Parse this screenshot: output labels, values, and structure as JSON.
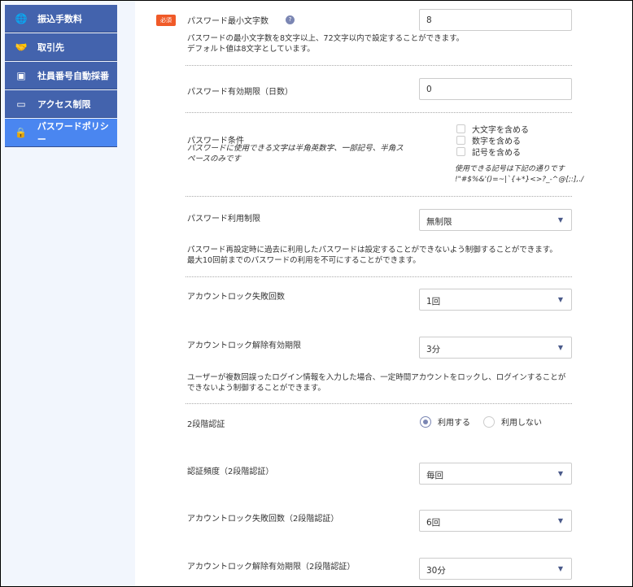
{
  "sidebar": {
    "items": [
      {
        "label": "振込手数料",
        "icon": "globe-yen-icon"
      },
      {
        "label": "取引先",
        "icon": "handshake-icon"
      },
      {
        "label": "社員番号自動採番",
        "icon": "id-card-icon"
      },
      {
        "label": "アクセス制限",
        "icon": "monitor-alert-icon"
      },
      {
        "label": "パスワードポリシー",
        "icon": "lock-icon",
        "active": true
      }
    ]
  },
  "form": {
    "required_badge": "必須",
    "min_length": {
      "label": "パスワード最小文字数",
      "help": "?",
      "value": "8",
      "desc1": "パスワードの最小文字数を8文字以上、72文字以内で設定することができます。",
      "desc2": "デフォルト値は8文字としています。"
    },
    "expiry": {
      "label": "パスワード有効期限（日数）",
      "value": "0"
    },
    "conditions": {
      "label": "パスワード条件",
      "note1": "パスワードに使用できる文字は半角英数字、一部記号、半角ス",
      "note2": "ペースのみです",
      "options": [
        {
          "label": "大文字を含める",
          "checked": false
        },
        {
          "label": "数字を含める",
          "checked": false
        },
        {
          "label": "記号を含める",
          "checked": false
        }
      ],
      "symbols_note": "使用できる記号は下記の通りです",
      "symbols": "!\"#$%&'()=~|`{+*}<>?_-^@[;:],./"
    },
    "reuse": {
      "label": "パスワード利用制限",
      "value": "無制限",
      "desc1": "パスワード再設定時に過去に利用したパスワードは設定することができないよう制御することができます。",
      "desc2": "最大10回前までのパスワードの利用を不可にすることができます。"
    },
    "lock_count": {
      "label": "アカウントロック失敗回数",
      "value": "1回"
    },
    "lock_expiry": {
      "label": "アカウントロック解除有効期限",
      "value": "3分",
      "desc1": "ユーザーが複数回誤ったログイン情報を入力した場合、一定時間アカウントをロックし、ログインすることが",
      "desc2": "できないよう制御することができます。"
    },
    "two_factor": {
      "label": "2段階認証",
      "options": [
        {
          "label": "利用する",
          "selected": true
        },
        {
          "label": "利用しない",
          "selected": false
        }
      ]
    },
    "tf_frequency": {
      "label": "認証頻度（2段階認証）",
      "value": "毎回"
    },
    "tf_lock_count": {
      "label": "アカウントロック失敗回数（2段階認証）",
      "value": "6回"
    },
    "tf_lock_expiry": {
      "label": "アカウントロック解除有効期限（2段階認証）",
      "value": "30分"
    }
  }
}
